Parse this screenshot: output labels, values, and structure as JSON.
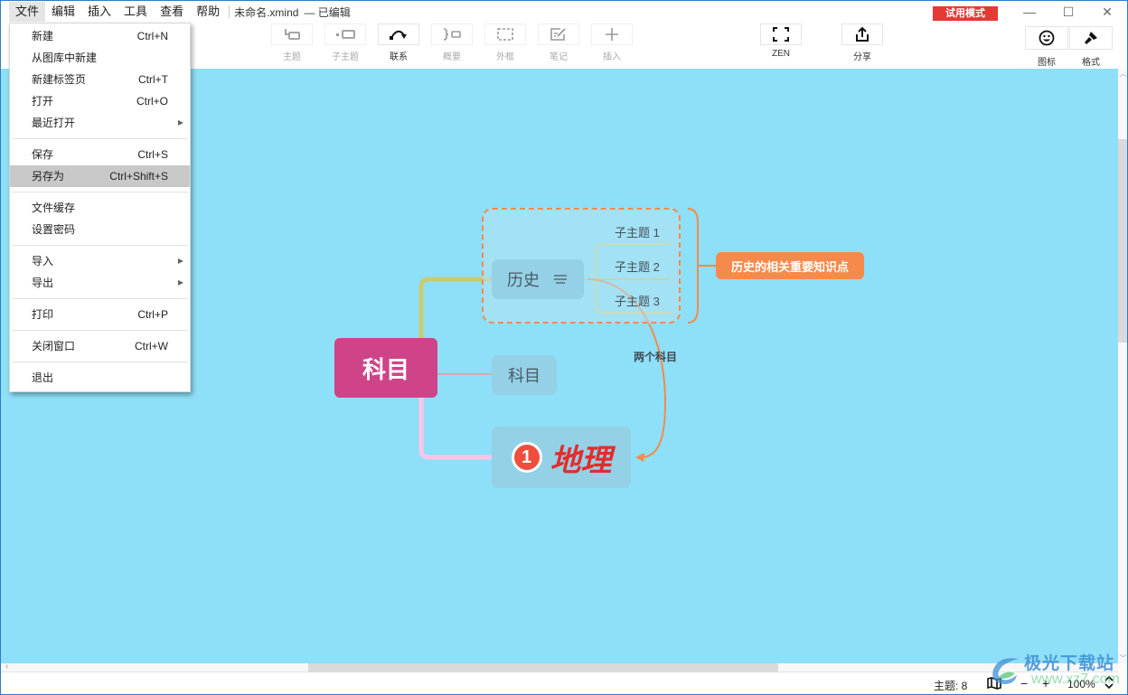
{
  "menubar": {
    "items": [
      "文件",
      "编辑",
      "插入",
      "工具",
      "查看",
      "帮助"
    ],
    "doc_title": "未命名.xmind",
    "doc_status": "— 已编辑",
    "trial_badge": "试用模式"
  },
  "window_controls": {
    "minimize": "—",
    "maximize": "☐",
    "close": "✕"
  },
  "toolbar": {
    "tools": [
      {
        "label": "主题",
        "icon": "topic-icon",
        "enabled": false
      },
      {
        "label": "子主题",
        "icon": "subtopic-icon",
        "enabled": false
      },
      {
        "label": "联系",
        "icon": "relationship-icon",
        "enabled": true
      },
      {
        "label": "概要",
        "icon": "summary-icon",
        "enabled": false
      },
      {
        "label": "外框",
        "icon": "boundary-icon",
        "enabled": false
      },
      {
        "label": "笔记",
        "icon": "note-icon",
        "enabled": false
      },
      {
        "label": "插入",
        "icon": "insert-icon",
        "enabled": false
      }
    ],
    "zen_label": "ZEN",
    "share_label": "分享",
    "icon_panel_label": "图标",
    "format_panel_label": "格式"
  },
  "file_menu": {
    "groups": [
      [
        {
          "label": "新建",
          "shortcut": "Ctrl+N"
        },
        {
          "label": "从图库中新建",
          "shortcut": ""
        },
        {
          "label": "新建标签页",
          "shortcut": "Ctrl+T"
        },
        {
          "label": "打开",
          "shortcut": "Ctrl+O"
        },
        {
          "label": "最近打开",
          "shortcut": "",
          "submenu": true
        }
      ],
      [
        {
          "label": "保存",
          "shortcut": "Ctrl+S"
        },
        {
          "label": "另存为",
          "shortcut": "Ctrl+Shift+S",
          "highlighted": true
        }
      ],
      [
        {
          "label": "文件缓存",
          "shortcut": ""
        },
        {
          "label": "设置密码",
          "shortcut": ""
        }
      ],
      [
        {
          "label": "导入",
          "shortcut": "",
          "submenu": true
        },
        {
          "label": "导出",
          "shortcut": "",
          "submenu": true
        }
      ],
      [
        {
          "label": "打印",
          "shortcut": "Ctrl+P"
        }
      ],
      [
        {
          "label": "关闭窗口",
          "shortcut": "Ctrl+W"
        }
      ],
      [
        {
          "label": "退出",
          "shortcut": ""
        }
      ]
    ]
  },
  "mindmap": {
    "root": "科目",
    "topics": {
      "history": "历史",
      "subject": "科目",
      "geography": "地理",
      "geography_marker": "1"
    },
    "subtopics": [
      "子主题 1",
      "子主题 2",
      "子主题 3"
    ],
    "summary": "历史的相关重要知识点",
    "relationship_label": "两个科目",
    "colors": {
      "canvas": "#8edff8",
      "root": "#cf4489",
      "summary": "#f58a4c",
      "relationship": "#f58a4c",
      "branch_history": "#c8cc70",
      "branch_subject": "#d6a9a9",
      "branch_geography": "#ffc5e8",
      "geography_text": "#e52b2b"
    }
  },
  "statusbar": {
    "topic_count": "主题: 8",
    "zoom_out": "−",
    "zoom_in": "+",
    "zoom_level": "100%"
  },
  "watermark": {
    "line1": "极光下载站",
    "line2": "www.xz7.com"
  },
  "annotation": {
    "arrow_color": "#e02020"
  }
}
